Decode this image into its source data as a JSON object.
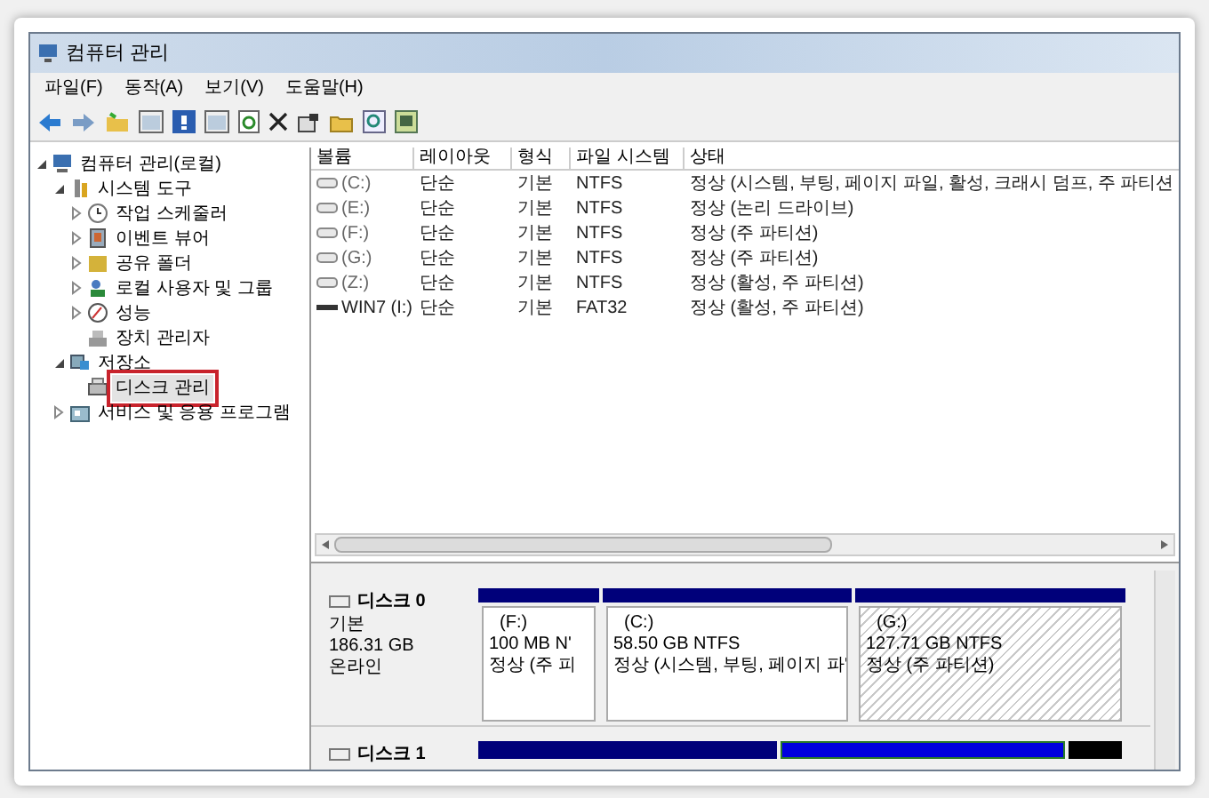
{
  "window": {
    "title": "컴퓨터 관리"
  },
  "menu": [
    "파일(F)",
    "동작(A)",
    "보기(V)",
    "도움말(H)"
  ],
  "tree": [
    {
      "label": "컴퓨터 관리(로컬)",
      "expanded": true,
      "selected": false,
      "children": [
        {
          "label": "시스템 도구",
          "expanded": true,
          "selected": false,
          "children": [
            {
              "label": "작업 스케줄러",
              "expanded": false,
              "selected": false
            },
            {
              "label": "이벤트 뷰어",
              "expanded": false,
              "selected": false
            },
            {
              "label": "공유 폴더",
              "expanded": false,
              "selected": false
            },
            {
              "label": "로컬 사용자 및 그룹",
              "expanded": false,
              "selected": false
            },
            {
              "label": "성능",
              "expanded": false,
              "selected": false
            },
            {
              "label": "장치 관리자",
              "selected": false
            }
          ]
        },
        {
          "label": "저장소",
          "expanded": true,
          "selected": false,
          "children": [
            {
              "label": "디스크 관리",
              "selected": true
            }
          ]
        },
        {
          "label": "서비스 및 응용 프로그램",
          "expanded": false,
          "selected": false
        }
      ]
    }
  ],
  "table": {
    "columns": [
      "볼륨",
      "레이아웃",
      "형식",
      "파일 시스템",
      "상태"
    ],
    "rows": [
      {
        "kind": "disk",
        "cells": [
          "(C:)",
          "단순",
          "기본",
          "NTFS",
          "정상 (시스템, 부팅, 페이지 파일, 활성, 크래시 덤프, 주 파티션"
        ]
      },
      {
        "kind": "disk",
        "cells": [
          "(E:)",
          "단순",
          "기본",
          "NTFS",
          "정상 (논리 드라이브)"
        ]
      },
      {
        "kind": "disk",
        "cells": [
          "(F:)",
          "단순",
          "기본",
          "NTFS",
          "정상 (주 파티션)"
        ]
      },
      {
        "kind": "disk",
        "cells": [
          "(G:)",
          "단순",
          "기본",
          "NTFS",
          "정상 (주 파티션)"
        ]
      },
      {
        "kind": "disk",
        "cells": [
          "(Z:)",
          "단순",
          "기본",
          "NTFS",
          "정상 (활성, 주 파티션)"
        ]
      },
      {
        "kind": "usb",
        "cells": [
          "WIN7 (I:)",
          "단순",
          "기본",
          "FAT32",
          "정상 (활성, 주 파티션)"
        ]
      }
    ]
  },
  "disks": [
    {
      "name": "디스크 0",
      "type": "기본",
      "size": "186.31 GB",
      "status": "온라인",
      "partitions": [
        {
          "name": "(F:)",
          "size": "100 MB N'",
          "status": "정상 (주 피",
          "hatched": false
        },
        {
          "name": "(C:)",
          "size": "58.50 GB NTFS",
          "status": "정상 (시스템, 부팅, 페이지 파'",
          "hatched": false
        },
        {
          "name": "(G:)",
          "size": "127.71 GB NTFS",
          "status": "정상 (주 파티션)",
          "hatched": true
        }
      ]
    },
    {
      "name": "디스크 1"
    }
  ]
}
